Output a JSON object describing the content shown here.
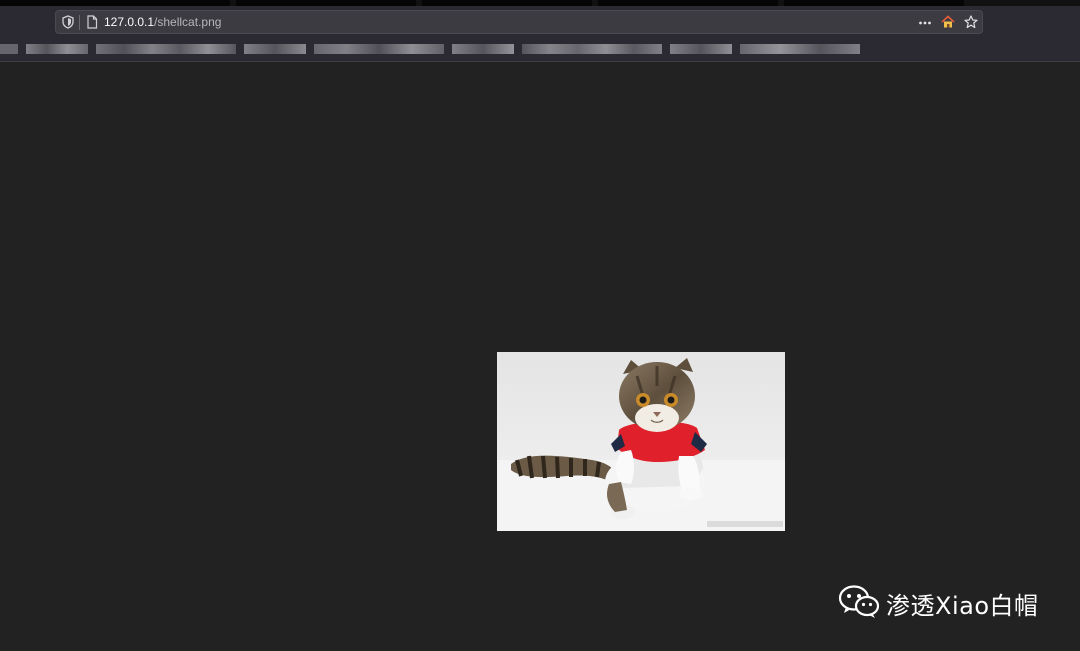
{
  "browser": {
    "address_bar": {
      "host": "127.0.0.1",
      "path": "/shellcat.png"
    },
    "icons": {
      "shield": "tracking-protection-icon",
      "page": "page-info-icon",
      "more": "more-actions-icon",
      "home": "home-icon",
      "bookmark": "bookmark-star-icon"
    }
  },
  "viewer": {
    "image_subject": "cat",
    "background_color": "#222222"
  },
  "watermark": {
    "text": "渗透Xiao白帽",
    "icon": "wechat-icon"
  }
}
